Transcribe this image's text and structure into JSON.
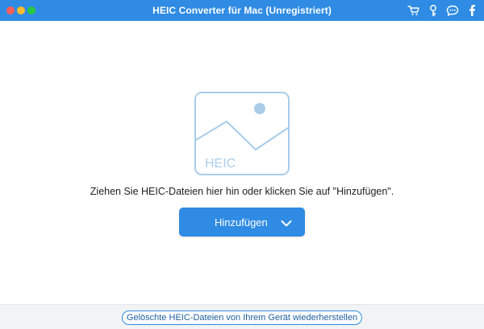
{
  "window": {
    "title": "HEIC Converter für Mac (Unregistriert)"
  },
  "toolbar_icons": [
    "cart-icon",
    "key-icon",
    "chat-icon",
    "facebook-icon"
  ],
  "main": {
    "placeholder_text": "HEIC",
    "hint": "Ziehen Sie HEIC-Dateien hier hin oder klicken Sie auf \"Hinzufügen\".",
    "add_button_label": "Hinzufügen"
  },
  "footer": {
    "restore_link": "Gelöschte HEIC-Dateien von Ihrem Gerät wiederherstellen"
  },
  "colors": {
    "accent": "#2f8be3",
    "placeholder": "#a9cde9",
    "footer_bg": "#f2f3f5"
  }
}
